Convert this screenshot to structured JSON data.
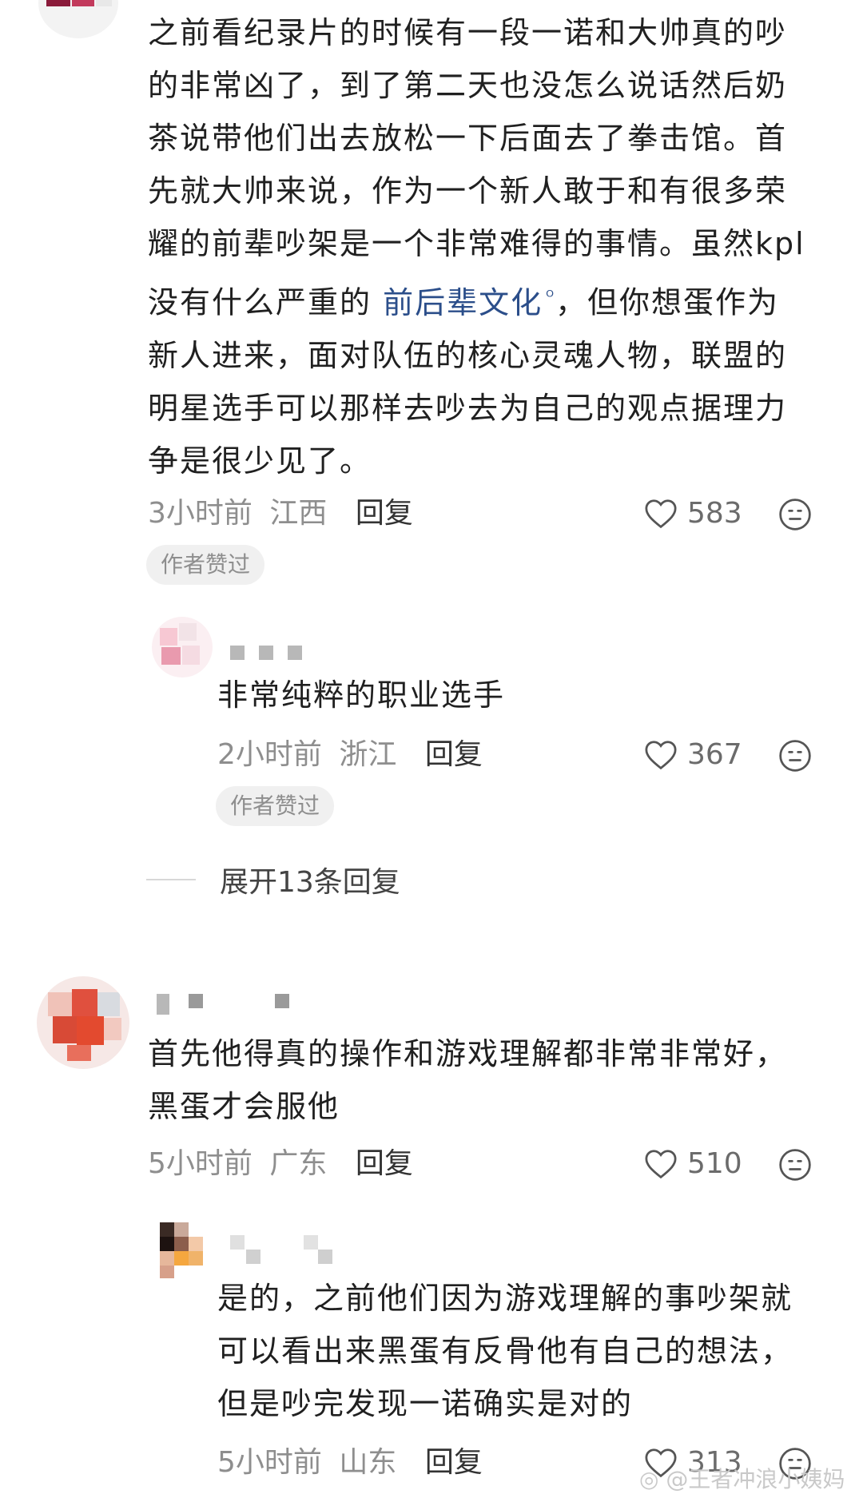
{
  "comments": [
    {
      "lines": [
        "之前看纪录片的时候有一段一诺和大帅真的吵",
        "的非常凶了，到了第二天也没怎么说话然后奶",
        "茶说带他们出去放松一下后面去了拳击馆。首",
        "先就大帅来说，作为一个新人敢于和有很多荣",
        "耀的前辈吵架是一个非常难得的事情。虽然kpl"
      ],
      "line6_pre": "没有什么严重的 ",
      "line6_link": "前后辈文化",
      "line6_post": "，但你想蛋作为",
      "lines_tail": [
        "新人进来，面对队伍的核心灵魂人物，联盟的",
        "明星选手可以那样去吵去为自己的观点据理力",
        "争是很少见了。"
      ],
      "time": "3小时前",
      "region": "江西",
      "reply": "回复",
      "likes": "583",
      "badge": "作者赞过"
    },
    {
      "text": "非常纯粹的职业选手",
      "time": "2小时前",
      "region": "浙江",
      "reply": "回复",
      "likes": "367",
      "badge": "作者赞过"
    },
    {
      "lines": [
        "首先他得真的操作和游戏理解都非常非常好，",
        "黑蛋才会服他"
      ],
      "time": "5小时前",
      "region": "广东",
      "reply": "回复",
      "likes": "510"
    },
    {
      "lines": [
        "是的，之前他们因为游戏理解的事吵架就",
        "可以看出来黑蛋有反骨他有自己的想法，",
        "但是吵完发现一诺确实是对的"
      ],
      "time": "5小时前",
      "region": "山东",
      "reply": "回复",
      "likes": "313"
    }
  ],
  "expand_replies": "展开13条回复",
  "watermark": "@王者冲浪小姨妈",
  "icons": {
    "like": "heart-outline-icon",
    "emoji": "neutral-face-icon"
  },
  "colors": {
    "link": "#2b4e8a",
    "meta": "#8e8e8e",
    "badge_bg": "#f0f0f0"
  }
}
